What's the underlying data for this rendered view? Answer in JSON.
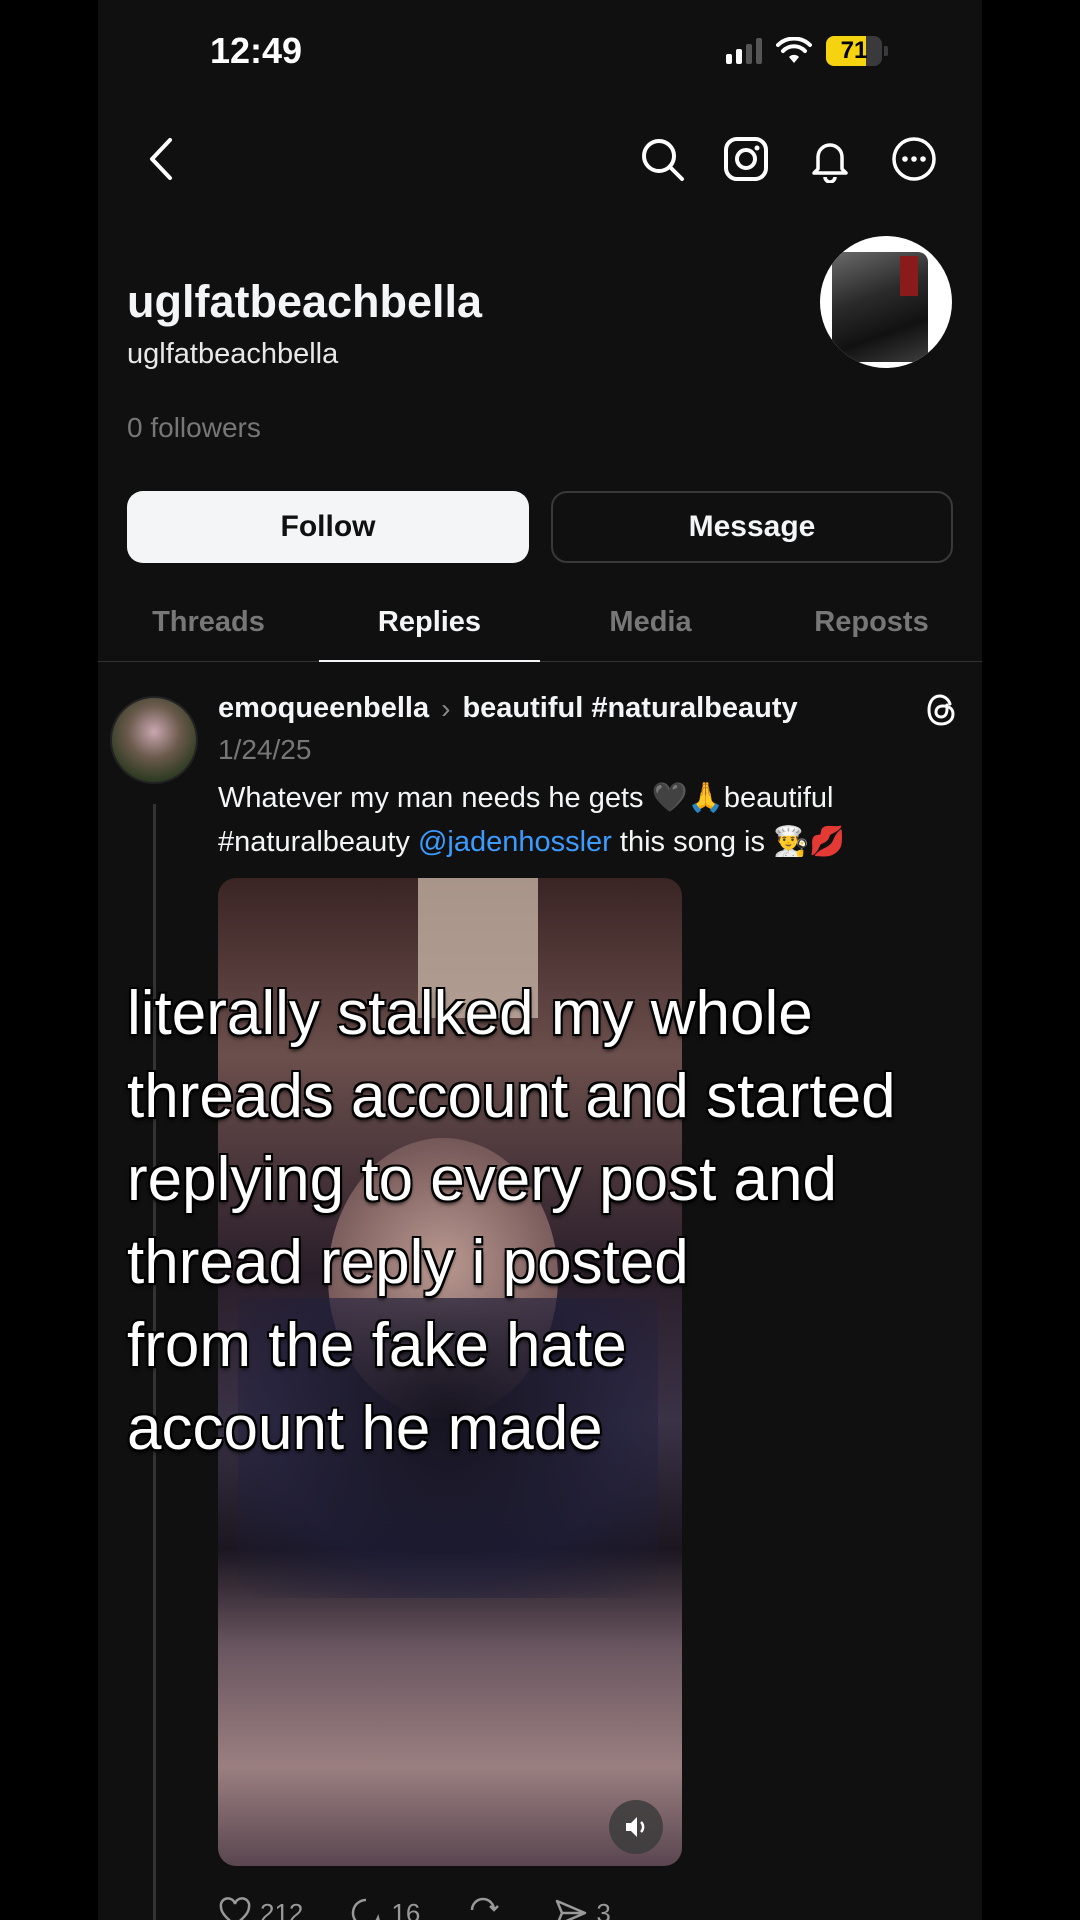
{
  "status_bar": {
    "time": "12:49",
    "battery": "71",
    "battery_level": 0.71,
    "battery_color": "#f5d40f"
  },
  "profile": {
    "display_name": "uglfatbeachbella",
    "handle": "uglfatbeachbella",
    "followers": "0 followers",
    "follow_label": "Follow",
    "message_label": "Message"
  },
  "tabs": [
    {
      "label": "Threads"
    },
    {
      "label": "Replies"
    },
    {
      "label": "Media"
    },
    {
      "label": "Reposts"
    }
  ],
  "active_tab": "Replies",
  "post": {
    "username": "emoqueenbella",
    "topic": "beautiful #naturalbeauty",
    "date": "1/24/25",
    "text_part1": "Whatever my man needs he gets 🖤🙏beautiful #naturalbeauty ",
    "mention": "@jadenhossler",
    "text_part2": " this song is 👨‍🍳💋",
    "overlay_text": "literally stalked my whole\nthreads account and started\nreplying to every post and\nthread reply i posted\nfrom the fake hate\naccount he made",
    "likes": "212",
    "comments": "16",
    "reposts": "",
    "shares": "3"
  },
  "colors": {
    "background": "#101010",
    "mention": "#3c9bff",
    "muted": "#777777"
  }
}
